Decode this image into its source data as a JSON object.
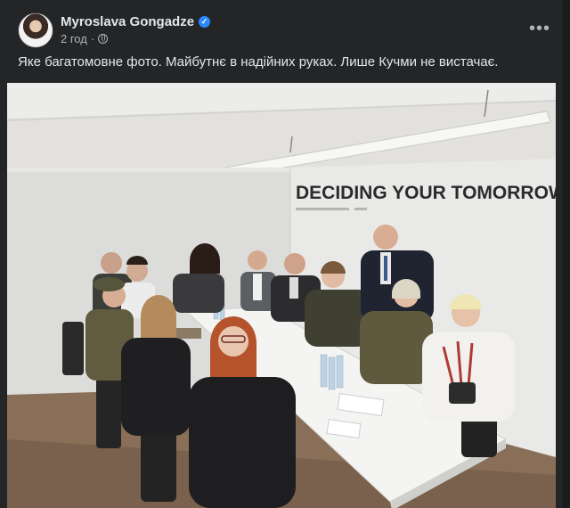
{
  "post": {
    "author": "Myroslava Gongadze",
    "time": "2 год",
    "separator": "·",
    "caption": "Яке багатомовне фото. Майбутнє в надійних руках. Лише Кучми не вистачає.",
    "more_label": "•••"
  },
  "photo": {
    "wall_slogan": "DECIDING YOUR TOMORROW"
  },
  "icons": {
    "verified": "verified-badge-icon",
    "audience": "globe-icon",
    "more": "more-options-icon"
  },
  "colors": {
    "verified": "#2d88ff",
    "background": "#242526",
    "text_primary": "#e4e6eb",
    "text_secondary": "#b0b3b8"
  }
}
